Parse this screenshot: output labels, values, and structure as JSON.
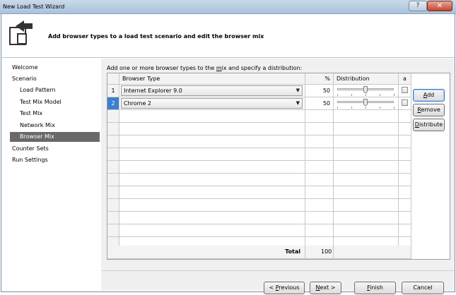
{
  "window": {
    "title": "New Load Test Wizard",
    "help_glyph": "?",
    "close_glyph": "✕"
  },
  "header": {
    "text": "Add browser types to a load test scenario and edit the browser mix",
    "icon": "wizard-icon"
  },
  "nav": {
    "items": [
      {
        "label": "Welcome",
        "level": 0
      },
      {
        "label": "Scenario",
        "level": 0
      },
      {
        "label": "Load Pattern",
        "level": 1
      },
      {
        "label": "Test Mix Model",
        "level": 1
      },
      {
        "label": "Test Mix",
        "level": 1
      },
      {
        "label": "Network Mix",
        "level": 1
      },
      {
        "label": "Browser Mix",
        "level": 1,
        "selected": true
      },
      {
        "label": "Counter Sets",
        "level": 0
      },
      {
        "label": "Run Settings",
        "level": 0
      }
    ]
  },
  "content": {
    "instruction_before": "Add one or more browser types to the ",
    "instruction_mnemonic": "m",
    "instruction_after": "ix and specify a distribution:",
    "grid": {
      "headers": {
        "browser": "Browser Type",
        "pct": "%",
        "distribution": "Distribution",
        "lock": "a"
      },
      "rows": [
        {
          "num": "1",
          "browser": "Internet Explorer 9.0",
          "pct": "50",
          "dist": 0.5
        },
        {
          "num": "2",
          "browser": "Chrome 2",
          "pct": "50",
          "dist": 0.5
        }
      ],
      "total_label": "Total",
      "total_value": "100"
    },
    "buttons": {
      "add": {
        "mn": "A",
        "rest": "dd"
      },
      "remove": {
        "mn": "R",
        "rest": "emove"
      },
      "distribute": {
        "mn": "D",
        "rest": "istribute"
      }
    }
  },
  "footer": {
    "previous": {
      "pre": "< ",
      "mn": "P",
      "rest": "revious"
    },
    "next": {
      "mn": "N",
      "rest": "ext >"
    },
    "finish": {
      "mn": "F",
      "rest": "inish"
    },
    "cancel": "Cancel"
  }
}
